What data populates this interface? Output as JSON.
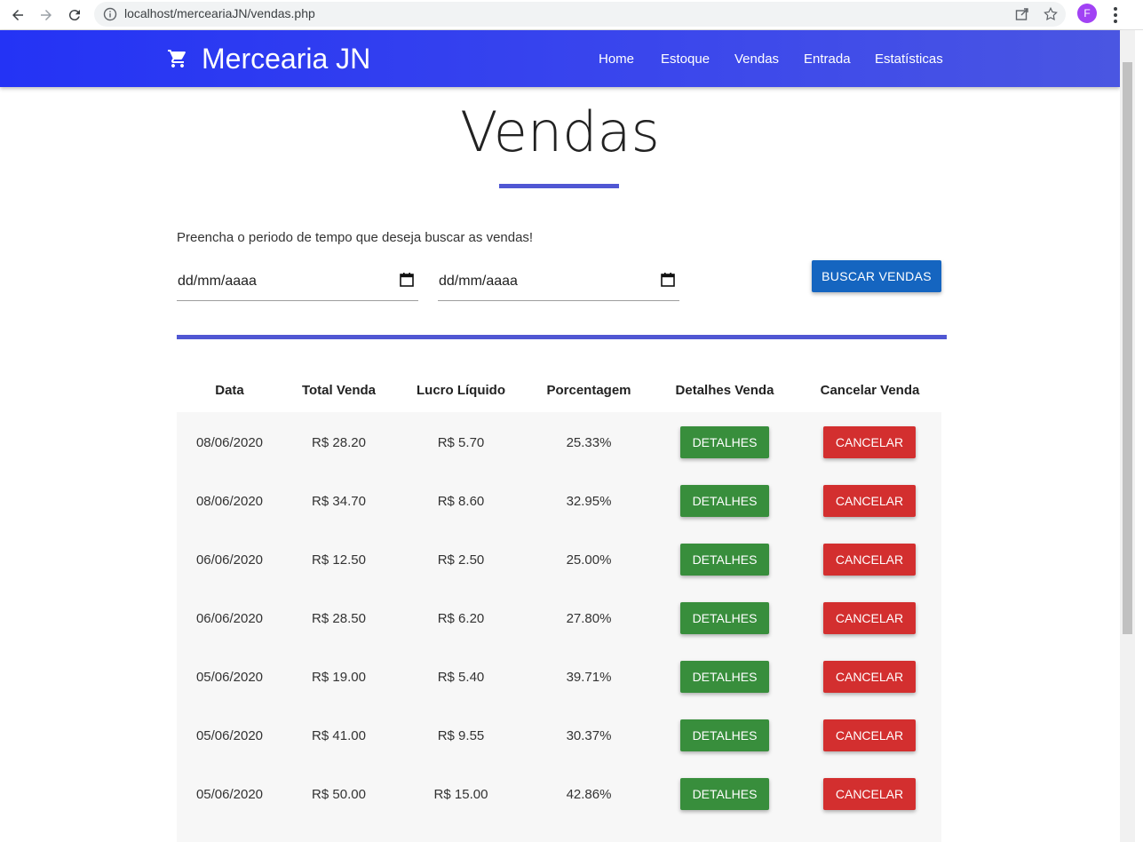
{
  "browser": {
    "url": "localhost/merceariaJN/vendas.php",
    "profile_initial": "F"
  },
  "nav": {
    "brand": "Mercearia JN",
    "links": [
      "Home",
      "Estoque",
      "Vendas",
      "Entrada",
      "Estatísticas"
    ]
  },
  "page": {
    "title": "Vendas",
    "instruction": "Preencha o periodo de tempo que deseja buscar as vendas!",
    "date_start_placeholder": "dd/mm/aaaa",
    "date_end_placeholder": "dd/mm/aaaa",
    "search_button": "BUSCAR VENDAS"
  },
  "table": {
    "headers": [
      "Data",
      "Total Venda",
      "Lucro Líquido",
      "Porcentagem",
      "Detalhes Venda",
      "Cancelar Venda"
    ],
    "details_label": "DETALHES",
    "cancel_label": "CANCELAR",
    "rows": [
      {
        "data": "08/06/2020",
        "total": "R$ 28.20",
        "lucro": "R$ 5.70",
        "porcentagem": "25.33%"
      },
      {
        "data": "08/06/2020",
        "total": "R$ 34.70",
        "lucro": "R$ 8.60",
        "porcentagem": "32.95%"
      },
      {
        "data": "06/06/2020",
        "total": "R$ 12.50",
        "lucro": "R$ 2.50",
        "porcentagem": "25.00%"
      },
      {
        "data": "06/06/2020",
        "total": "R$ 28.50",
        "lucro": "R$ 6.20",
        "porcentagem": "27.80%"
      },
      {
        "data": "05/06/2020",
        "total": "R$ 19.00",
        "lucro": "R$ 5.40",
        "porcentagem": "39.71%"
      },
      {
        "data": "05/06/2020",
        "total": "R$ 41.00",
        "lucro": "R$ 9.55",
        "porcentagem": "30.37%"
      },
      {
        "data": "05/06/2020",
        "total": "R$ 50.00",
        "lucro": "R$ 15.00",
        "porcentagem": "42.86%"
      }
    ]
  },
  "colors": {
    "nav_bg": "#2433f5",
    "accent_line": "#5057d3",
    "search_button": "#1565c0",
    "details_button": "#388e3c",
    "cancel_button": "#d32f2f"
  }
}
